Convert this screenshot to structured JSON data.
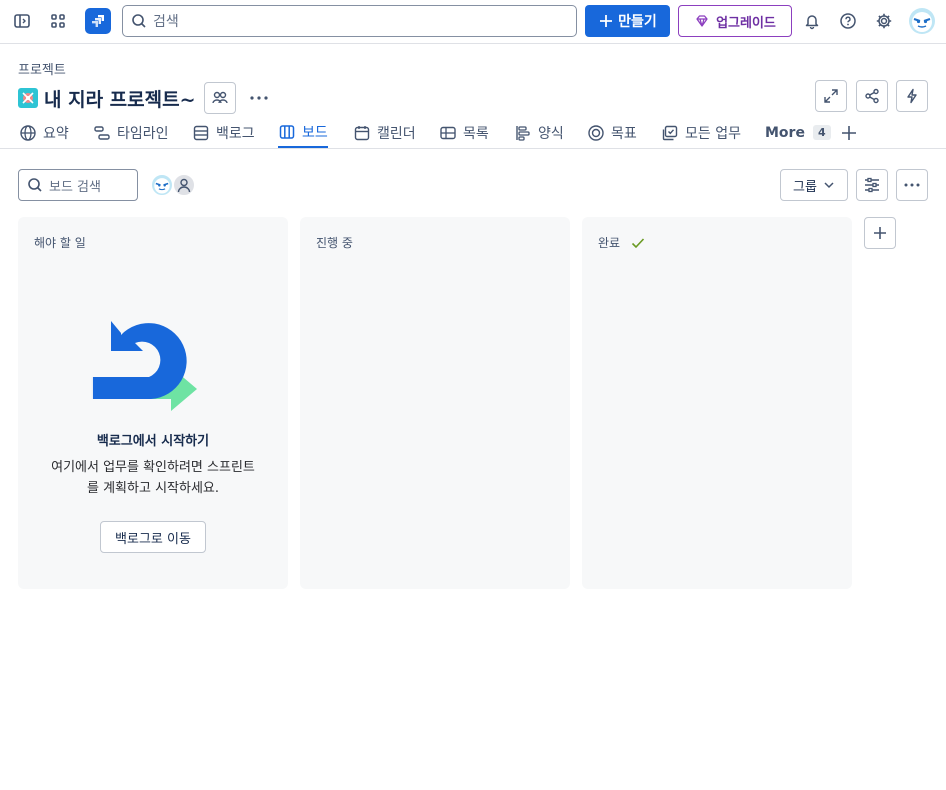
{
  "topbar": {
    "search_placeholder": "검색",
    "create_label": "만들기",
    "upgrade_label": "업그레이드"
  },
  "header": {
    "breadcrumb": "프로젝트",
    "title": "내 지라 프로젝트~"
  },
  "tabs": [
    {
      "label": "요약",
      "icon": "globe-icon"
    },
    {
      "label": "타임라인",
      "icon": "timeline-icon"
    },
    {
      "label": "백로그",
      "icon": "backlog-icon"
    },
    {
      "label": "보드",
      "icon": "board-icon",
      "active": true
    },
    {
      "label": "캘린더",
      "icon": "calendar-icon"
    },
    {
      "label": "목록",
      "icon": "list-icon"
    },
    {
      "label": "양식",
      "icon": "form-icon"
    },
    {
      "label": "목표",
      "icon": "goal-icon"
    },
    {
      "label": "모든 업무",
      "icon": "all-work-icon"
    },
    {
      "label": "More",
      "count": "4"
    }
  ],
  "toolbar": {
    "board_search_placeholder": "보드 검색",
    "group_label": "그룹"
  },
  "columns": [
    {
      "title": "해야 할 일"
    },
    {
      "title": "진행 중"
    },
    {
      "title": "완료",
      "done": true
    }
  ],
  "empty_state": {
    "title": "백로그에서 시작하기",
    "text": "여기에서 업무를 확인하려면 스프린트를 계획하고 시작하세요.",
    "button_label": "백로그로 이동"
  },
  "colors": {
    "primary": "#1868db",
    "upgrade": "#8c3fbf",
    "done_check": "#6a9a23",
    "project_icon": "#2ec4d4"
  }
}
